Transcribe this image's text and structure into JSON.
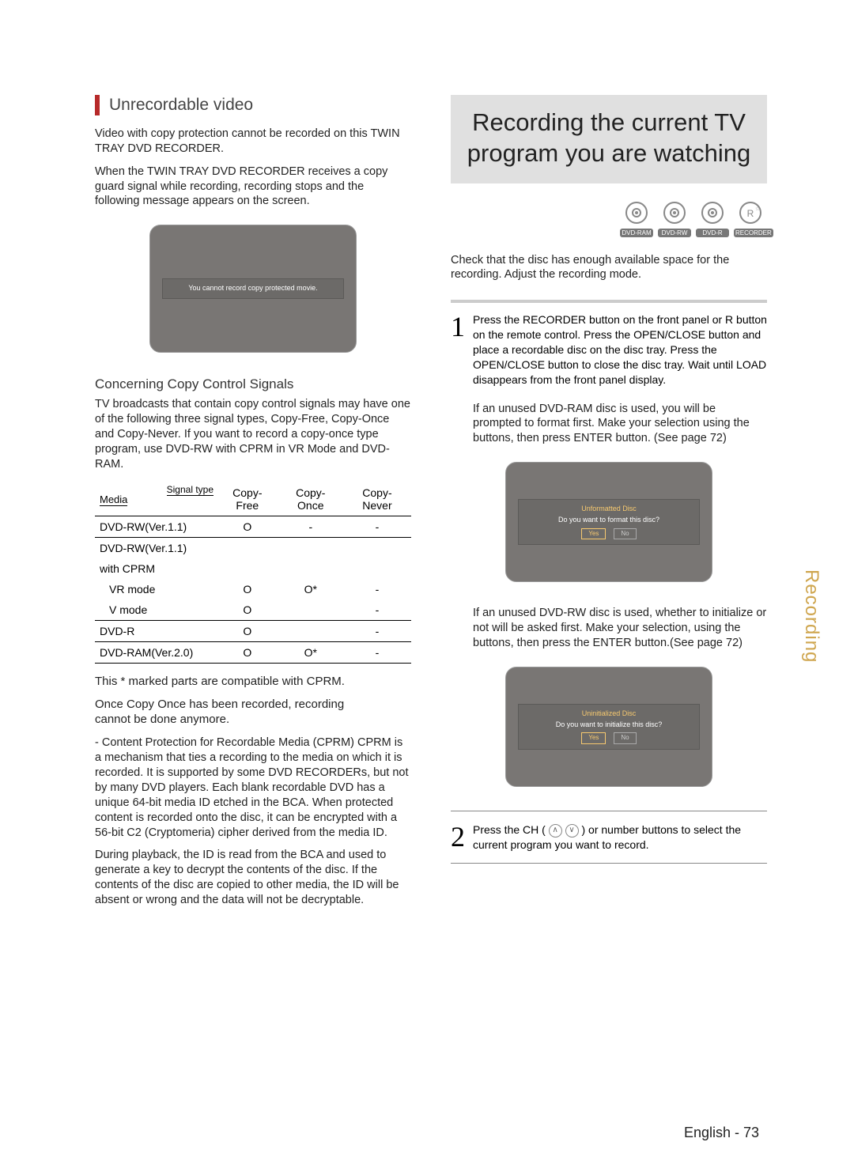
{
  "left": {
    "heading": "Unrecordable video",
    "intro1": "Video with copy protection cannot be recorded on this TWIN TRAY DVD RECORDER.",
    "intro2": "When the TWIN TRAY DVD RECORDER receives a copy guard signal while recording, recording stops and the following message appears on the screen.",
    "tv_msg": "You cannot record copy protected movie.",
    "subhead": "Concerning Copy Control Signals",
    "copy_para": "TV broadcasts that contain copy control signals may have one of the following three signal types, Copy-Free, Copy-Once and Copy-Never. If you want to record a copy-once type program, use DVD-RW with CPRM in VR Mode and DVD-RAM.",
    "table": {
      "media_label": "Media",
      "signal_label": "Signal type",
      "cols": [
        "Copy-Free",
        "Copy-Once",
        "Copy-Never"
      ],
      "rows": [
        {
          "name": "DVD-RW(Ver.1.1)",
          "vals": [
            "O",
            "-",
            "-"
          ],
          "noborder": false
        },
        {
          "name": "DVD-RW(Ver.1.1)",
          "vals": [
            "",
            "",
            ""
          ],
          "noborder": true
        },
        {
          "name": "with CPRM",
          "vals": [
            "",
            "",
            ""
          ],
          "noborder": true
        },
        {
          "name": "VR mode",
          "vals": [
            "O",
            "O*",
            "-"
          ],
          "noborder": true,
          "indent": true
        },
        {
          "name": "V mode",
          "vals": [
            "O",
            "",
            "-"
          ],
          "noborder": false,
          "indent": true
        },
        {
          "name": "DVD-R",
          "vals": [
            "O",
            "",
            "-"
          ],
          "noborder": false
        },
        {
          "name": "DVD-RAM(Ver.2.0)",
          "vals": [
            "O",
            "O*",
            "-"
          ],
          "noborder": false
        }
      ]
    },
    "note1": "This * marked parts are compatible with CPRM.",
    "note2a": "Once  Copy Once  has been recorded, recording",
    "note2b": "cannot be done anymore.",
    "note3": "- Content Protection for Recordable Media (CPRM) CPRM is a mechanism that ties a recording to the media on which it is recorded. It is supported by some DVD RECORDERs, but not by many DVD players. Each blank recordable DVD has a unique 64-bit media ID etched in the BCA. When protected content is recorded onto the disc, it can be encrypted with a 56-bit C2 (Cryptomeria) cipher derived from the media ID.",
    "note4": "During playback, the ID is read from the BCA and used to generate a key to decrypt the contents of the disc. If the contents of the disc are copied to other media, the ID will be absent or wrong and the data will not be decryptable."
  },
  "right": {
    "feature_title": "Recording the current TV program you are watching",
    "discs": [
      "DVD-RAM",
      "DVD-RW",
      "DVD-R",
      "RECORDER"
    ],
    "check_para": "Check that the disc has enough available space for the recording. Adjust the recording mode.",
    "step1_num": "1",
    "step1_text": "Press the RECORDER button on the front panel or R button on the remote control. Press the OPEN/CLOSE button and place a recordable disc on the disc tray. Press the OPEN/CLOSE button to close the disc tray. Wait until LOAD disappears from the front panel display.",
    "ram_para": "If an unused DVD-RAM disc is used, you will be prompted to format first. Make your selection using the       buttons, then press ENTER button. (See page 72)",
    "tv1_title": "Unformatted Disc",
    "tv1_msg": "Do you want to format this disc?",
    "yes": "Yes",
    "no": "No",
    "rw_para": "If an unused DVD-RW disc is used, whether to initialize or not will be asked first. Make your selection, using the        buttons, then press the ENTER button.(See page 72)",
    "tv2_title": "Uninitialized Disc",
    "tv2_msg": "Do you want to initialize this disc?",
    "step2_num": "2",
    "step2_text_a": "Press the CH (",
    "step2_text_b": ") or number buttons to select the current program you want to record."
  },
  "side_tab": "Recording",
  "footer": "English - 73",
  "chart_data": {
    "type": "table",
    "title": "Copy Control Signals by Media",
    "columns": [
      "Media",
      "Copy-Free",
      "Copy-Once",
      "Copy-Never"
    ],
    "rows": [
      [
        "DVD-RW(Ver.1.1)",
        "O",
        "-",
        "-"
      ],
      [
        "DVD-RW(Ver.1.1) with CPRM VR mode",
        "O",
        "O*",
        "-"
      ],
      [
        "DVD-RW(Ver.1.1) with CPRM V mode",
        "O",
        "",
        "-"
      ],
      [
        "DVD-R",
        "O",
        "",
        "-"
      ],
      [
        "DVD-RAM(Ver.2.0)",
        "O",
        "O*",
        "-"
      ]
    ],
    "note": "* compatible with CPRM"
  }
}
